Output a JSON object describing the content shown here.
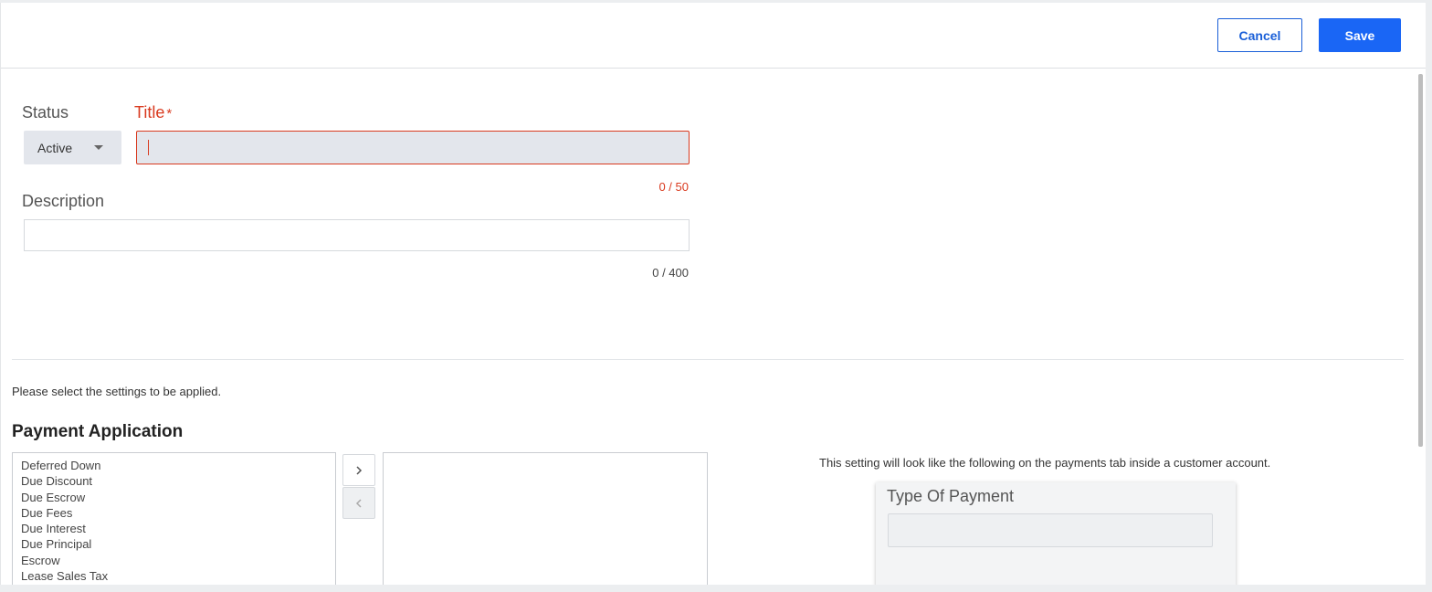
{
  "header": {
    "cancel_label": "Cancel",
    "save_label": "Save"
  },
  "form": {
    "status": {
      "label": "Status",
      "selected": "Active"
    },
    "title": {
      "label": "Title",
      "required_marker": "*",
      "value": "",
      "counter": "0 / 50"
    },
    "description": {
      "label": "Description",
      "value": "",
      "counter": "0 / 400"
    }
  },
  "settings": {
    "hint": "Please select the settings to be applied.",
    "section_title": "Payment Application",
    "available_items": [
      "Deferred Down",
      "Due Discount",
      "Due Escrow",
      "Due Fees",
      "Due Interest",
      "Due Principal",
      "Escrow",
      "Lease Sales Tax"
    ],
    "selected_items": [],
    "move_right_icon": "chevron-right-icon",
    "move_left_icon": "chevron-left-icon"
  },
  "preview": {
    "note": "This setting will look like the following on the payments tab inside a customer account.",
    "field_label": "Type Of Payment"
  },
  "colors": {
    "primary": "#1a66f5",
    "error": "#d93a1f"
  }
}
